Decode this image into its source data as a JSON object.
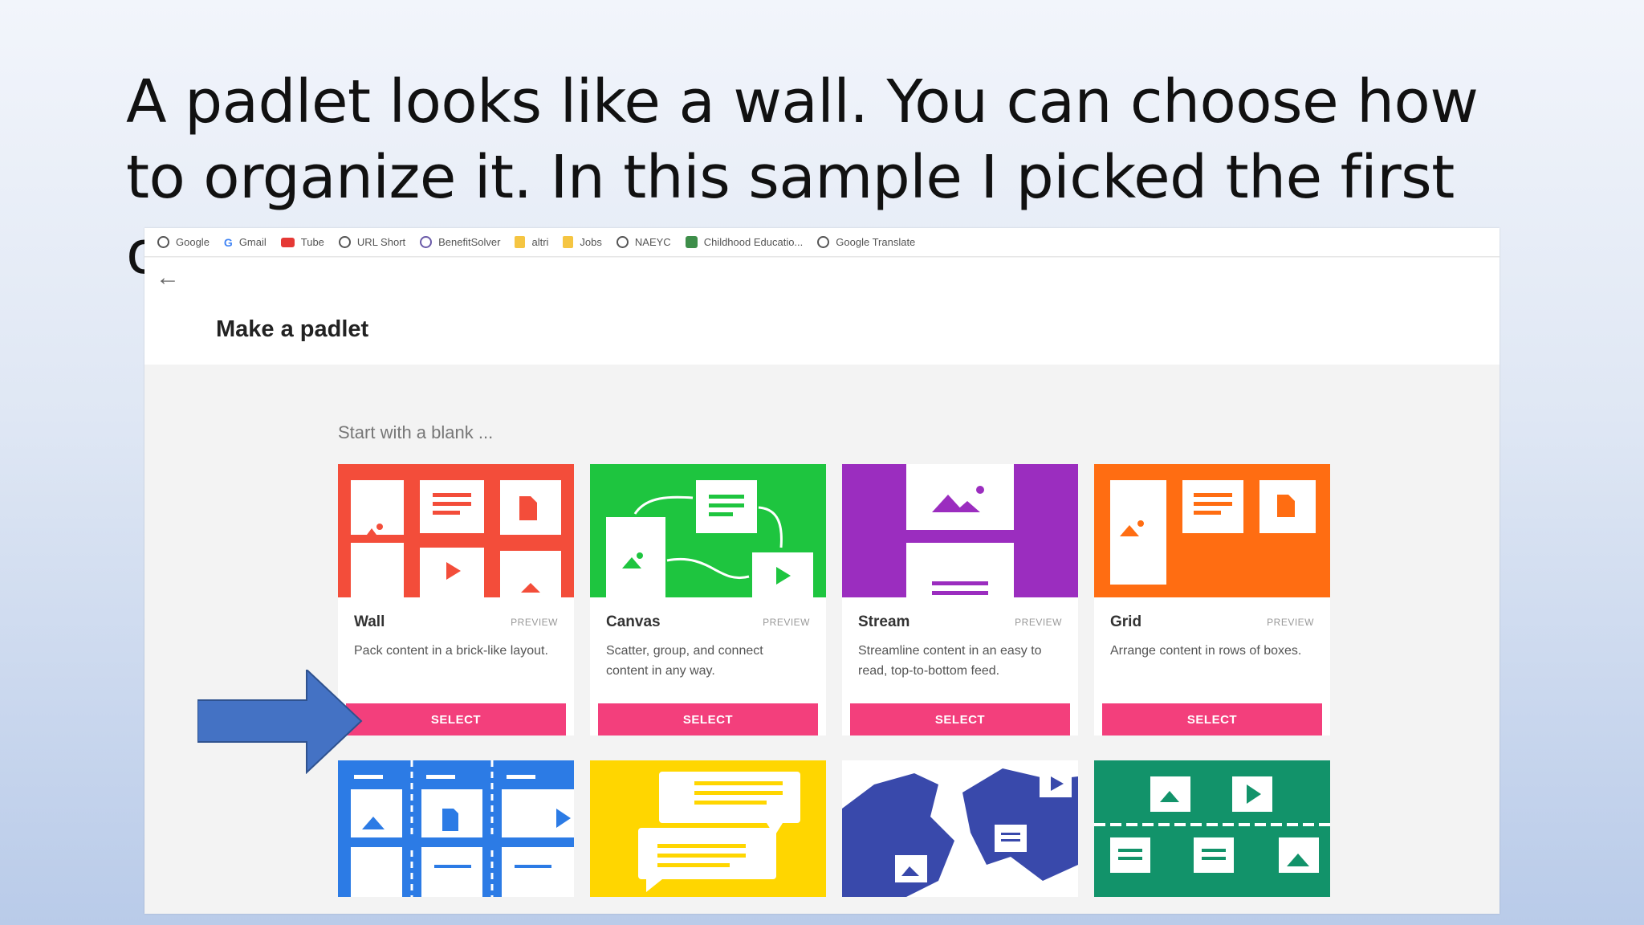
{
  "slide": {
    "title": "A padlet looks like a wall. You can choose how to organize it. In this sample I picked the first one."
  },
  "bookmarks": [
    {
      "label": "Google",
      "icon": "globe-icon"
    },
    {
      "label": "Gmail",
      "icon": "google-icon"
    },
    {
      "label": "Tube",
      "icon": "youtube-icon"
    },
    {
      "label": "URL Short",
      "icon": "globe-icon"
    },
    {
      "label": "BenefitSolver",
      "icon": "benefitsolver-icon"
    },
    {
      "label": "altri",
      "icon": "folder-icon"
    },
    {
      "label": "Jobs",
      "icon": "folder-icon"
    },
    {
      "label": "NAEYC",
      "icon": "globe-icon"
    },
    {
      "label": "Childhood Educatio...",
      "icon": "site-icon"
    },
    {
      "label": "Google Translate",
      "icon": "globe-icon"
    }
  ],
  "page": {
    "back_icon": "back-arrow-icon",
    "title": "Make a padlet",
    "subtitle": "Start with a blank ..."
  },
  "cards": [
    {
      "name": "Wall",
      "preview": "PREVIEW",
      "description": "Pack content in a brick-like layout.",
      "select": "SELECT",
      "color": "#f34d3a"
    },
    {
      "name": "Canvas",
      "preview": "PREVIEW",
      "description": "Scatter, group, and connect content in any way.",
      "select": "SELECT",
      "color": "#1ec53f"
    },
    {
      "name": "Stream",
      "preview": "PREVIEW",
      "description": "Streamline content in an easy to read, top-to-bottom feed.",
      "select": "SELECT",
      "color": "#9b2dbf"
    },
    {
      "name": "Grid",
      "preview": "PREVIEW",
      "description": "Arrange content in rows of boxes.",
      "select": "SELECT",
      "color": "#ff6d12"
    }
  ],
  "second_row_colors": [
    "#2c7be5",
    "#ffd600",
    "#3949ab",
    "#12936a"
  ],
  "colors": {
    "select_button": "#f33f7c",
    "annotation_arrow": "#4472c4"
  }
}
